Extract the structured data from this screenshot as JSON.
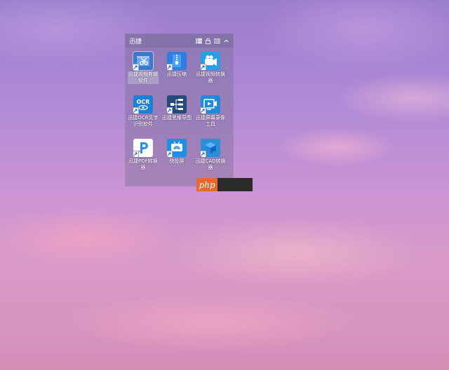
{
  "fence": {
    "title": "迅捷",
    "tools": [
      "list-view-icon",
      "lock-icon",
      "menu-icon",
      "collapse-icon"
    ]
  },
  "apps": [
    {
      "label": "迅捷视频剪辑软件",
      "icon": "video-edit-icon",
      "color": "#3f78c8",
      "selected": true
    },
    {
      "label": "迅捷压缩",
      "icon": "zip-icon",
      "color": "#2f7fe0"
    },
    {
      "label": "迅捷视频转换器",
      "icon": "video-convert-icon",
      "color": "#2b9ee8"
    },
    {
      "label": "迅捷OCR文字识别软件",
      "icon": "ocr-icon",
      "color": "#1d7fd6"
    },
    {
      "label": "迅捷思维导图",
      "icon": "mindmap-icon",
      "color": "#244a7a"
    },
    {
      "label": "迅捷屏幕录像工具",
      "icon": "screen-record-icon",
      "color": "#1f8ad8"
    },
    {
      "label": "迅捷PDF转换器",
      "icon": "pdf-icon",
      "color": "#ffffff"
    },
    {
      "label": "快投屏",
      "icon": "cast-icon",
      "color": "#1e8fe6"
    },
    {
      "label": "迅捷CAD转换器",
      "icon": "cad-icon",
      "color": "#2d8fd8"
    }
  ],
  "badge": {
    "text": "php"
  }
}
